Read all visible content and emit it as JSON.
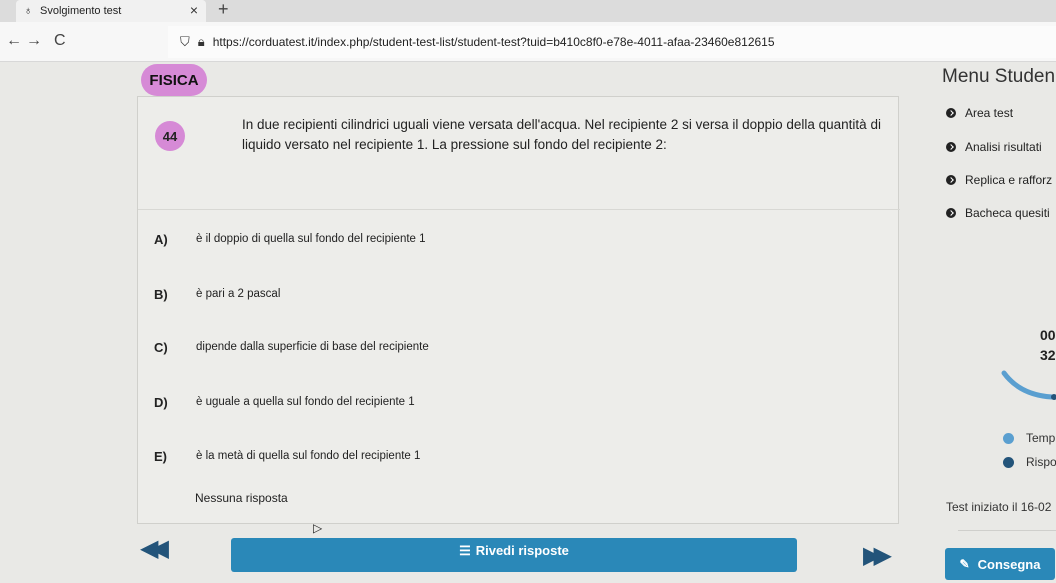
{
  "browser": {
    "tab_title": "Svolgimento test",
    "tab_close": "×",
    "new_tab": "+",
    "back": "←",
    "forward": "→",
    "reload": "C",
    "url": "https://corduatest.it/index.php/student-test-list/student-test?tuid=b410c8f0-e78e-4011-afaa-23460e812615"
  },
  "subject": "FISICA",
  "menu_title": "Menu Studen",
  "question": {
    "number": "44",
    "text": "In due recipienti cilindrici uguali viene versata dell'acqua. Nel recipiente 2 si versa il doppio della quantità di liquido versato nel recipiente 1. La pressione sul fondo del recipiente 2:"
  },
  "options": [
    {
      "letter": "A)",
      "text": "è il doppio di quella sul fondo del recipiente 1"
    },
    {
      "letter": "B)",
      "text": "è pari a 2 pascal"
    },
    {
      "letter": "C)",
      "text": "dipende dalla superficie di base del recipiente"
    },
    {
      "letter": "D)",
      "text": "è uguale a quella sul fondo del recipiente 1"
    },
    {
      "letter": "E)",
      "text": "è la metà di quella sul fondo del recipiente 1"
    }
  ],
  "no_answer": "Nessuna risposta",
  "menu": [
    {
      "label": "Area test"
    },
    {
      "label": "Analisi risultati"
    },
    {
      "label": "Replica e rafforz"
    },
    {
      "label": "Bacheca quesiti"
    }
  ],
  "timer": {
    "line1": "00",
    "line2": "32"
  },
  "legend": [
    {
      "label": "Temp",
      "color": "#5a9fd0"
    },
    {
      "label": "Rispo",
      "color": "#23547a"
    }
  ],
  "started": "Test iniziato il 16-02",
  "review_label": "Rivedi risposte",
  "submit_label": "Consegna",
  "colors": {
    "accent": "#d68ad6",
    "primary": "#2a88b8",
    "nav": "#23547a"
  }
}
